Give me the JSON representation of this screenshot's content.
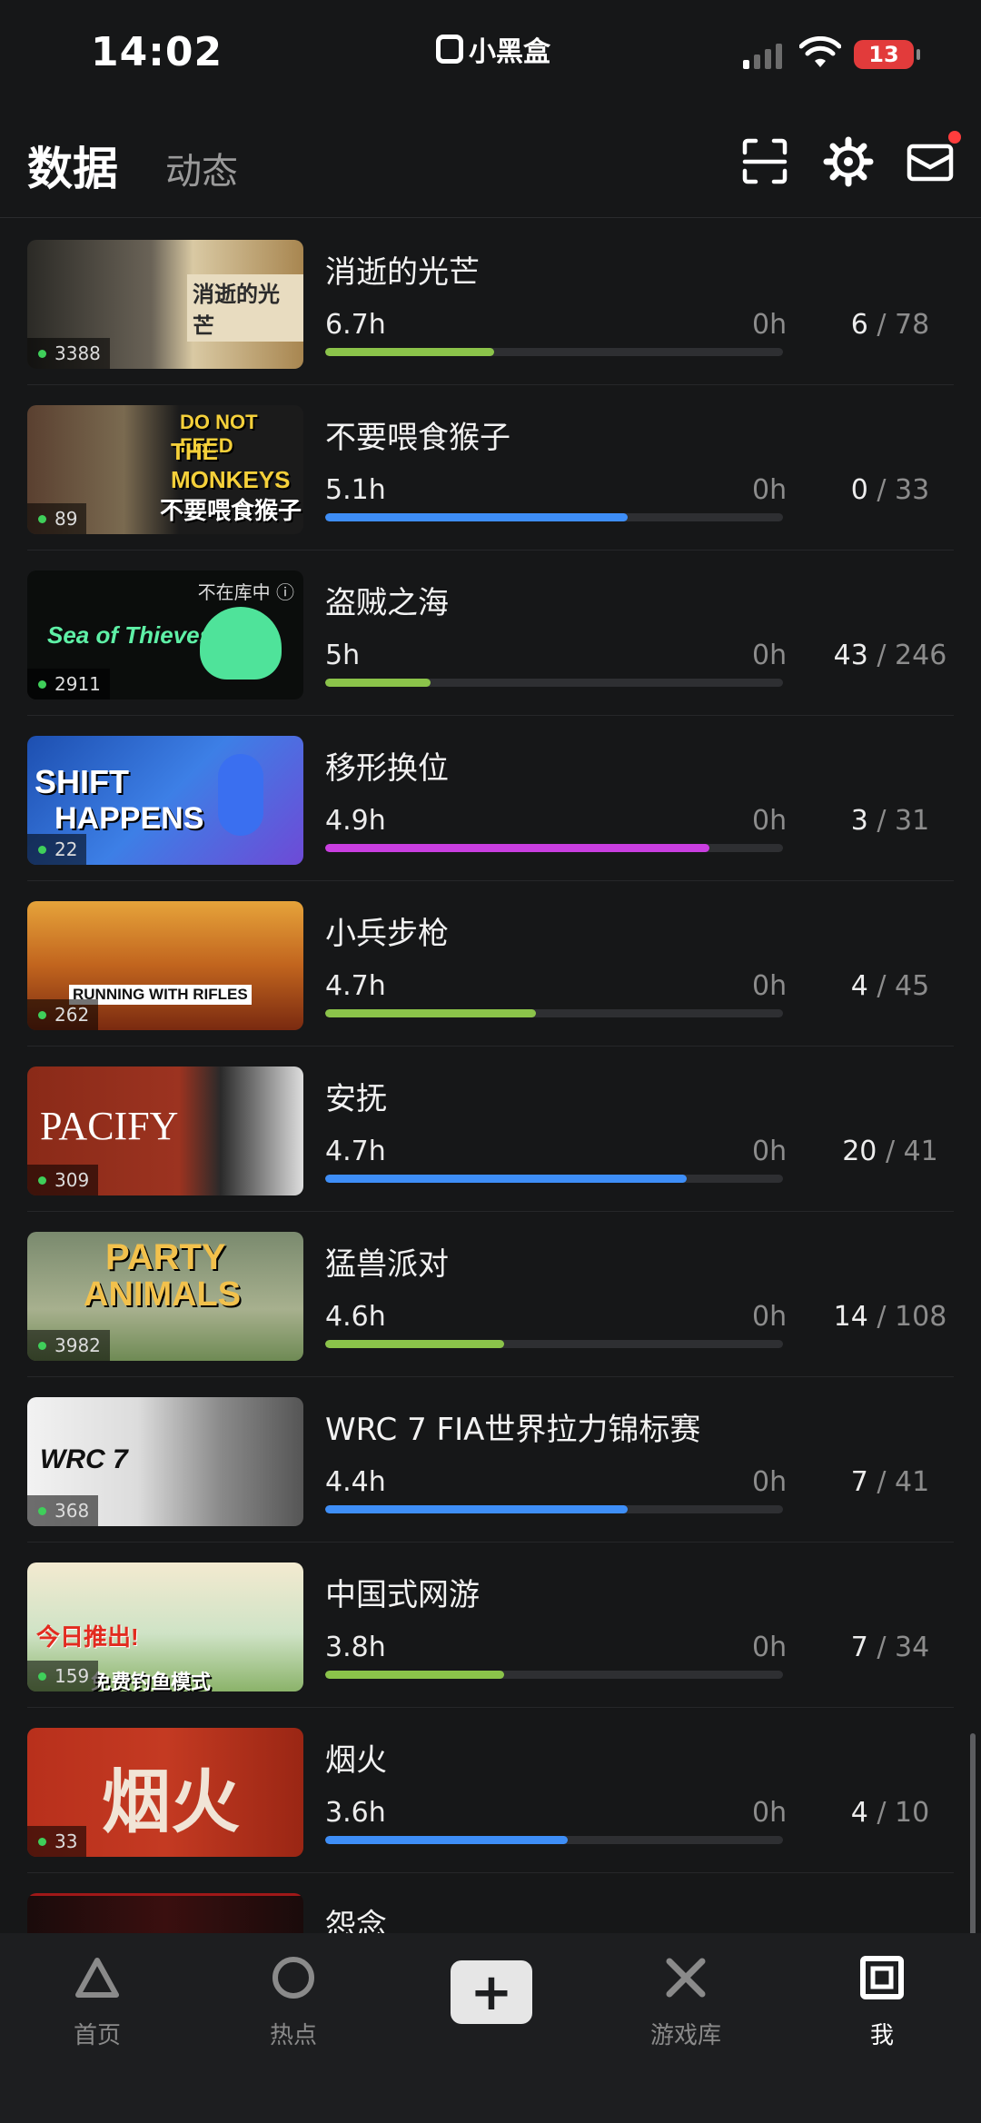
{
  "status_bar": {
    "time": "14:02",
    "app_name": "小黑盒",
    "battery": "13"
  },
  "header": {
    "tab_active": "数据",
    "tab_inactive": "动态"
  },
  "games": [
    {
      "title": "消逝的光芒",
      "hours": "6.7h",
      "zero": "0h",
      "ach_done": "6",
      "ach_total": "78",
      "owners": "3388",
      "progress": 0.37,
      "color": "#8bc34a"
    },
    {
      "title": "不要喂食猴子",
      "hours": "5.1h",
      "zero": "0h",
      "ach_done": "0",
      "ach_total": "33",
      "owners": "89",
      "progress": 0.66,
      "color": "#3e8ef7"
    },
    {
      "title": "盗贼之海",
      "hours": "5h",
      "zero": "0h",
      "ach_done": "43",
      "ach_total": "246",
      "owners": "2911",
      "progress": 0.23,
      "color": "#8bc34a",
      "not_in_library": "不在库中 ⓘ"
    },
    {
      "title": "移形换位",
      "hours": "4.9h",
      "zero": "0h",
      "ach_done": "3",
      "ach_total": "31",
      "owners": "22",
      "progress": 0.84,
      "color": "#c93ee0"
    },
    {
      "title": "小兵步枪",
      "hours": "4.7h",
      "zero": "0h",
      "ach_done": "4",
      "ach_total": "45",
      "owners": "262",
      "progress": 0.46,
      "color": "#8bc34a"
    },
    {
      "title": "安抚",
      "hours": "4.7h",
      "zero": "0h",
      "ach_done": "20",
      "ach_total": "41",
      "owners": "309",
      "progress": 0.79,
      "color": "#3e8ef7"
    },
    {
      "title": "猛兽派对",
      "hours": "4.6h",
      "zero": "0h",
      "ach_done": "14",
      "ach_total": "108",
      "owners": "3982",
      "progress": 0.39,
      "color": "#8bc34a"
    },
    {
      "title": "WRC 7 FIA世界拉力锦标赛",
      "hours": "4.4h",
      "zero": "0h",
      "ach_done": "7",
      "ach_total": "41",
      "owners": "368",
      "progress": 0.66,
      "color": "#3e8ef7"
    },
    {
      "title": "中国式网游",
      "hours": "3.8h",
      "zero": "0h",
      "ach_done": "7",
      "ach_total": "34",
      "owners": "159",
      "progress": 0.39,
      "color": "#8bc34a"
    },
    {
      "title": "烟火",
      "hours": "3.6h",
      "zero": "0h",
      "ach_done": "4",
      "ach_total": "10",
      "owners": "33",
      "progress": 0.53,
      "color": "#3e8ef7"
    },
    {
      "title": "怨念"
    }
  ],
  "thumb_text": {
    "dying_light": "消逝的光芒",
    "monkeys_a": "DO NOT FEED",
    "monkeys_b": "THE MONKEYS",
    "monkeys_c": "不要喂食猴子",
    "sot": "Sea of Thieves",
    "shift_a": "SHIFT",
    "shift_b": "HAPPENS",
    "rwr": "RUNNING WITH RIFLES",
    "pacify": "PACIFY",
    "party_a": "PARTY",
    "party_b": "ANIMALS",
    "wrc": "WRC 7",
    "cn_a": "今日推出!",
    "cn_b": "免费钓鱼模式",
    "fireworks": "烟火"
  },
  "nav": [
    {
      "label": "首页",
      "icon": "triangle-icon"
    },
    {
      "label": "热点",
      "icon": "circle-icon"
    },
    {
      "label": "+",
      "icon": "plus-icon"
    },
    {
      "label": "游戏库",
      "icon": "cross-icon"
    },
    {
      "label": "我",
      "icon": "square-icon"
    }
  ]
}
